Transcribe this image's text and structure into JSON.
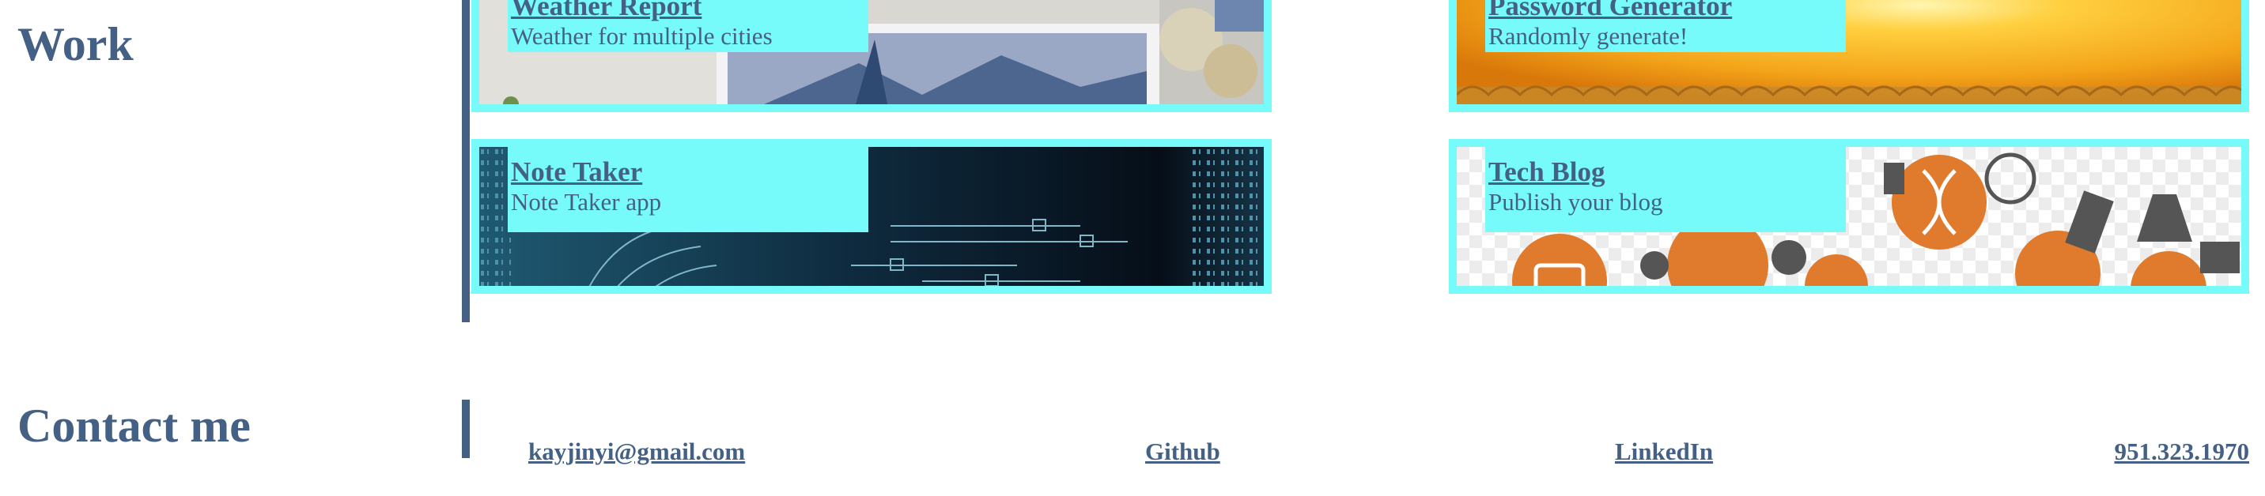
{
  "work": {
    "heading": "Work",
    "projects": [
      {
        "title": "Weather Report",
        "description": "Weather for multiple cities"
      },
      {
        "title": "Password Generator",
        "description": "Randomly generate!"
      },
      {
        "title": "Note Taker",
        "description": "Note Taker app"
      },
      {
        "title": "Tech Blog",
        "description": "Publish your blog"
      }
    ]
  },
  "contact": {
    "heading": "Contact me",
    "email": "kayjinyi@gmail.com",
    "github": "Github",
    "linkedin": "LinkedIn",
    "phone": "951.323.1970"
  },
  "colors": {
    "accent": "#446185",
    "card_border": "#76fafa"
  }
}
